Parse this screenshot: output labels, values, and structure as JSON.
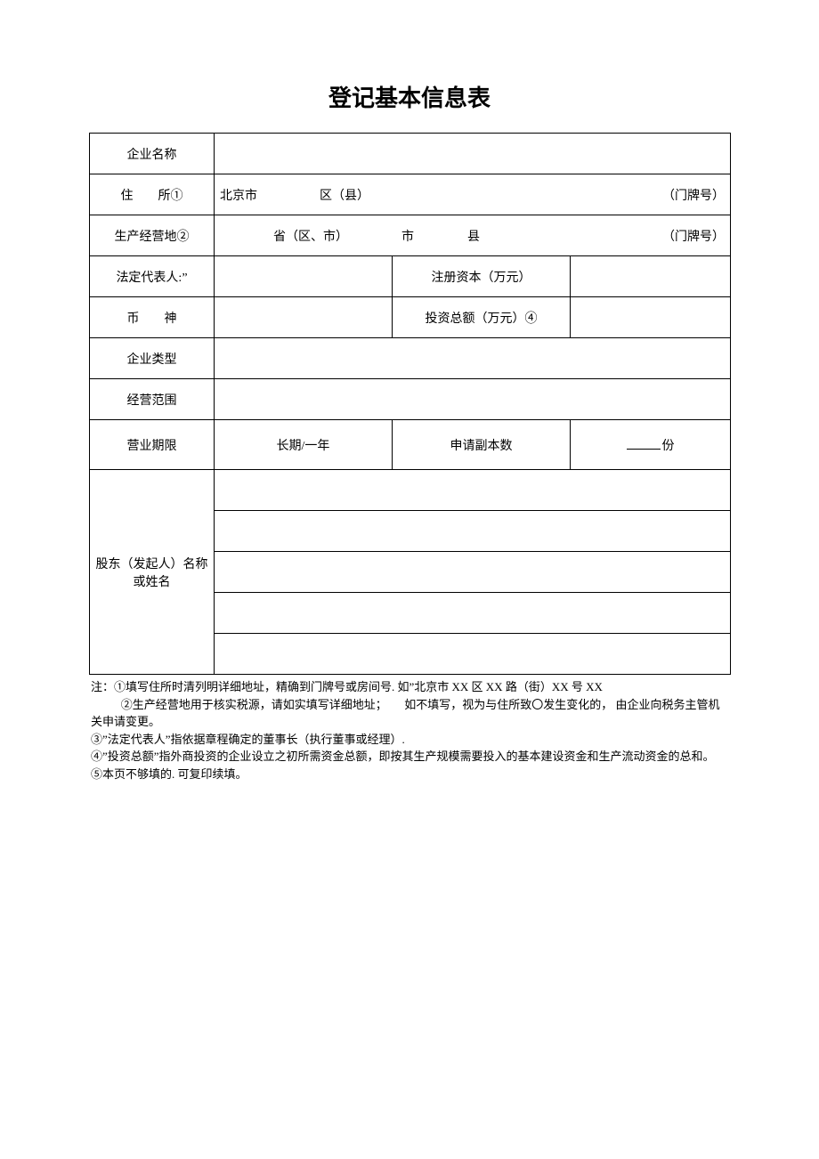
{
  "title": "登记基本信息表",
  "labels": {
    "company_name": "企业名称",
    "address": "住　　所①",
    "address_prefix": "北京市",
    "address_district": "区（县）",
    "address_suffix": "（门牌号）",
    "prod_place": "生产经营地②",
    "prod_province": "省（区、市）",
    "prod_city": "市",
    "prod_county": "县",
    "prod_suffix": "（门牌号）",
    "legal_rep": "法定代表人:”",
    "reg_capital": "注册资本（万元）",
    "currency": "币　　神",
    "total_invest": "投资总额（万元）④",
    "company_type": "企业类型",
    "biz_scope": "经营范围",
    "biz_term": "营业期限",
    "term_value": "长期/一年",
    "copy_count": "申请副本数",
    "copy_unit": "份",
    "shareholders": "股东（发起人）名称或姓名"
  },
  "notes": {
    "line1": "注：①填写住所时清列明详细地址，精确到门牌号或房间号. 如”北京市 XX 区 XX 路（街）XX 号 XX",
    "line2": "②生产经营地用于核实税源，请如实填写详细地址；　　如不填写，视为与住所致〇发生变化的， 由企业向税务主管机关申请变更。",
    "line3": "③”法定代表人”指依据章程确定的董事长（执行董事或经理）.",
    "line4": "④”投资总额”指外商投资的企业设立之初所需资金总额，即按其生产规模需要投入的基本建设资金和生产流动资金的总和。",
    "line5": "⑤本页不够填的. 可复印续填。"
  }
}
